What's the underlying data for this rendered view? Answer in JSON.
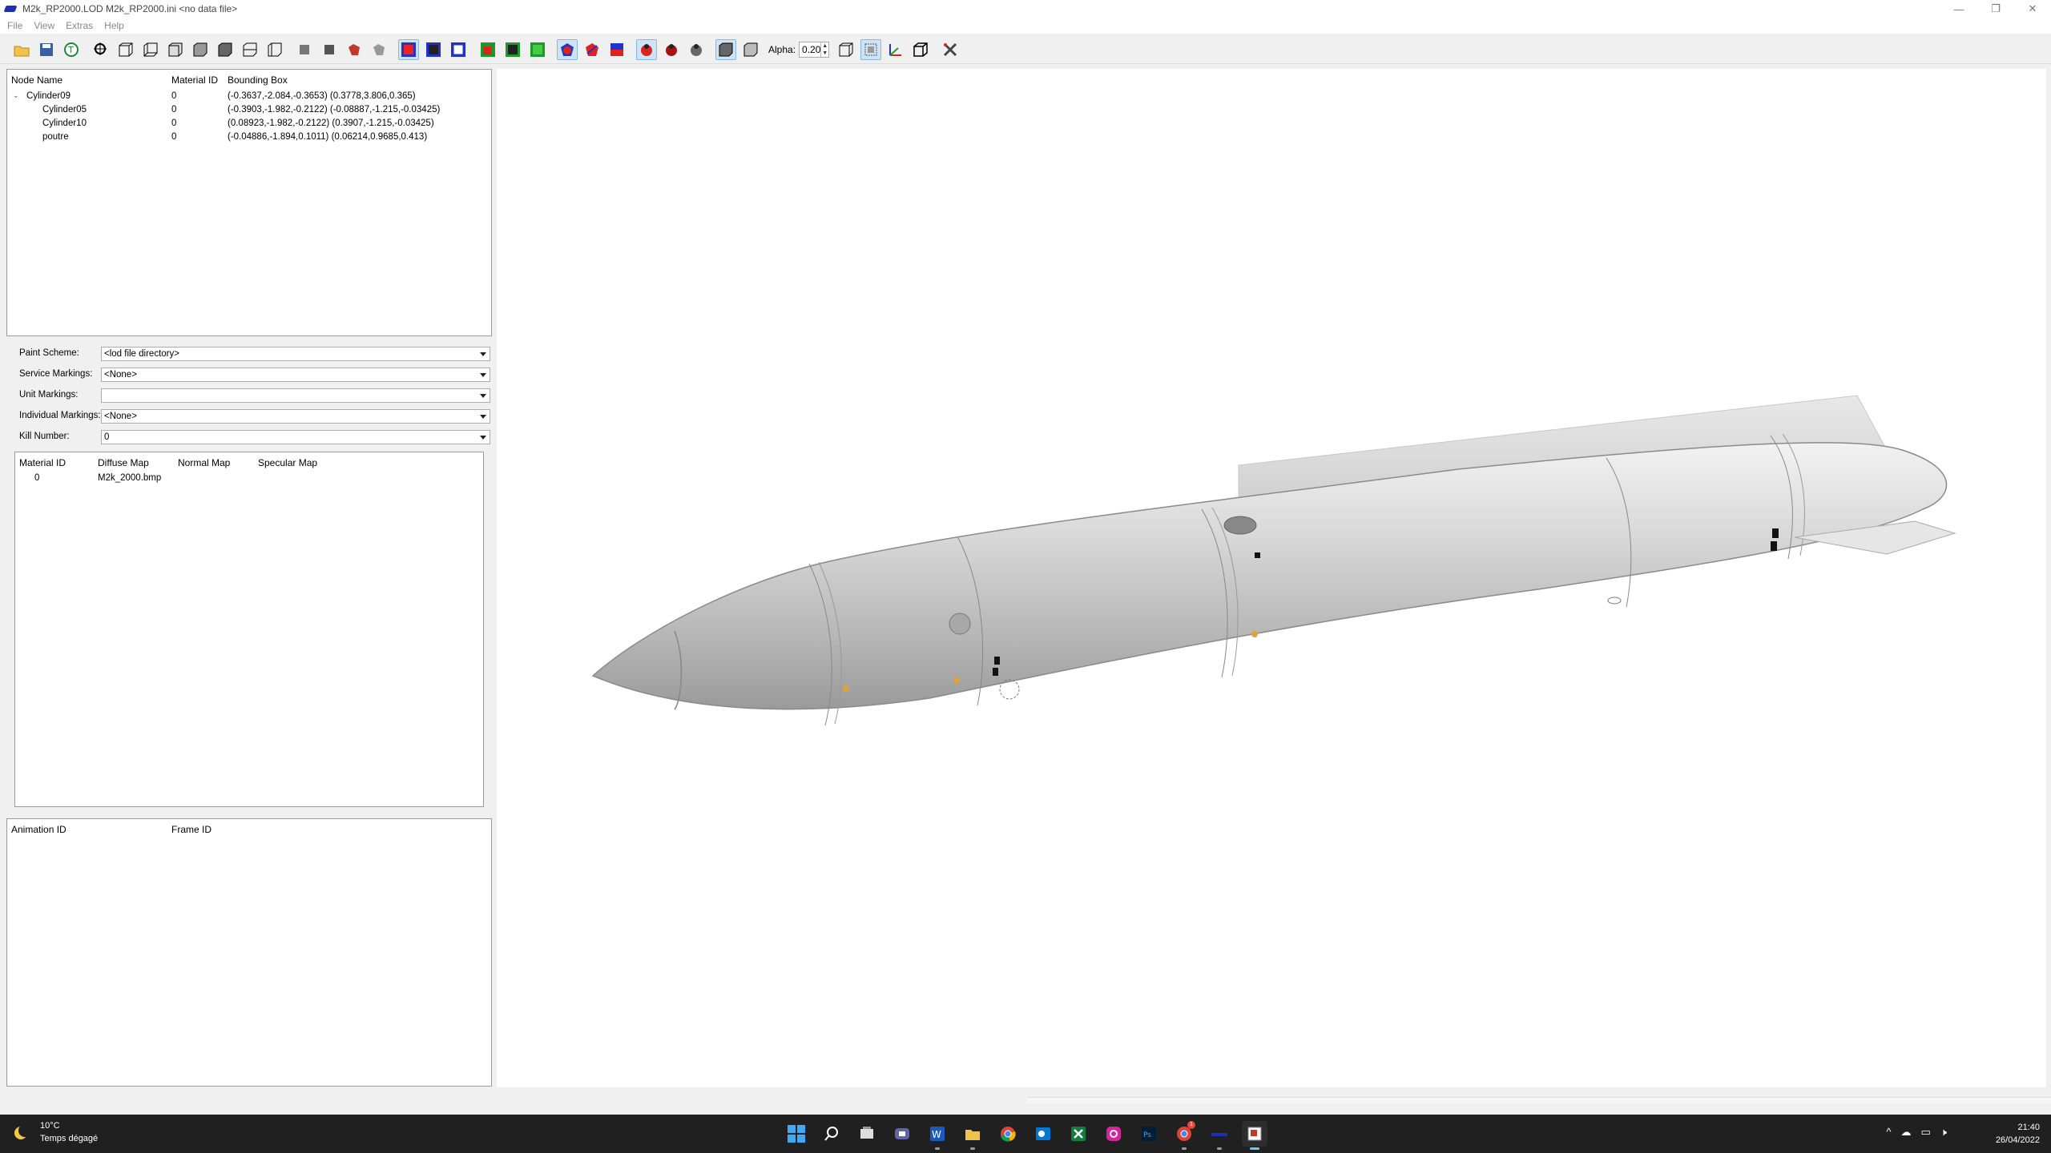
{
  "window": {
    "title": "M2k_RP2000.LOD  M2k_RP2000.ini  <no data file>",
    "controls": [
      "—",
      "❐",
      "✕"
    ]
  },
  "menu": [
    "File",
    "View",
    "Extras",
    "Help"
  ],
  "toolbar": {
    "alpha_label": "Alpha:",
    "alpha_value": "0.20"
  },
  "node_tree": {
    "headers": {
      "name": "Node Name",
      "material": "Material ID",
      "bbox": "Bounding Box"
    },
    "rows": [
      {
        "name": "Cylinder09",
        "material": "0",
        "bbox": "(-0.3637,-2.084,-0.3653) (0.3778,3.806,0.365)",
        "expander": "⌄"
      },
      {
        "name": "Cylinder05",
        "material": "0",
        "bbox": "(-0.3903,-1.982,-0.2122) (-0.08887,-1.215,-0.03425)"
      },
      {
        "name": "Cylinder10",
        "material": "0",
        "bbox": "(0.08923,-1.982,-0.2122) (0.3907,-1.215,-0.03425)"
      },
      {
        "name": "poutre",
        "material": "0",
        "bbox": "(-0.04886,-1.894,0.1011) (0.06214,0.9685,0.413)"
      }
    ]
  },
  "properties": {
    "paint_scheme": {
      "label": "Paint Scheme:",
      "value": "<lod file directory>"
    },
    "service_markings": {
      "label": "Service Markings:",
      "value": "<None>"
    },
    "unit_markings": {
      "label": "Unit Markings:",
      "value": ""
    },
    "individual_markings": {
      "label": "Individual Markings:",
      "value": "<None>"
    },
    "kill_number": {
      "label": "Kill Number:",
      "value": "0"
    }
  },
  "materials": {
    "headers": {
      "id": "Material ID",
      "diffuse": "Diffuse Map",
      "normal": "Normal Map",
      "specular": "Specular Map"
    },
    "rows": [
      {
        "id": "0",
        "diffuse": "M2k_2000.bmp",
        "normal": "",
        "specular": ""
      }
    ]
  },
  "animations": {
    "headers": {
      "anim": "Animation ID",
      "frame": "Frame ID"
    }
  },
  "taskbar": {
    "weather_temp": "10°C",
    "weather_cond": "Temps dégagé",
    "apps": [
      "windows-start",
      "search",
      "task-view",
      "teams-chat",
      "word",
      "file-explorer",
      "chrome",
      "outlook",
      "excel",
      "instagram",
      "photoshop",
      "chrome-profile",
      "lod-viewer",
      "lod-editor"
    ],
    "chrome_badge": "1",
    "time": "21:40",
    "date": "26/04/2022",
    "tray": [
      "^",
      "☁",
      "▭",
      "🕨"
    ]
  },
  "colors": {
    "taskbar_bg": "#202020",
    "accent": "#60cdff",
    "model_fill": "#c8c8c8"
  }
}
